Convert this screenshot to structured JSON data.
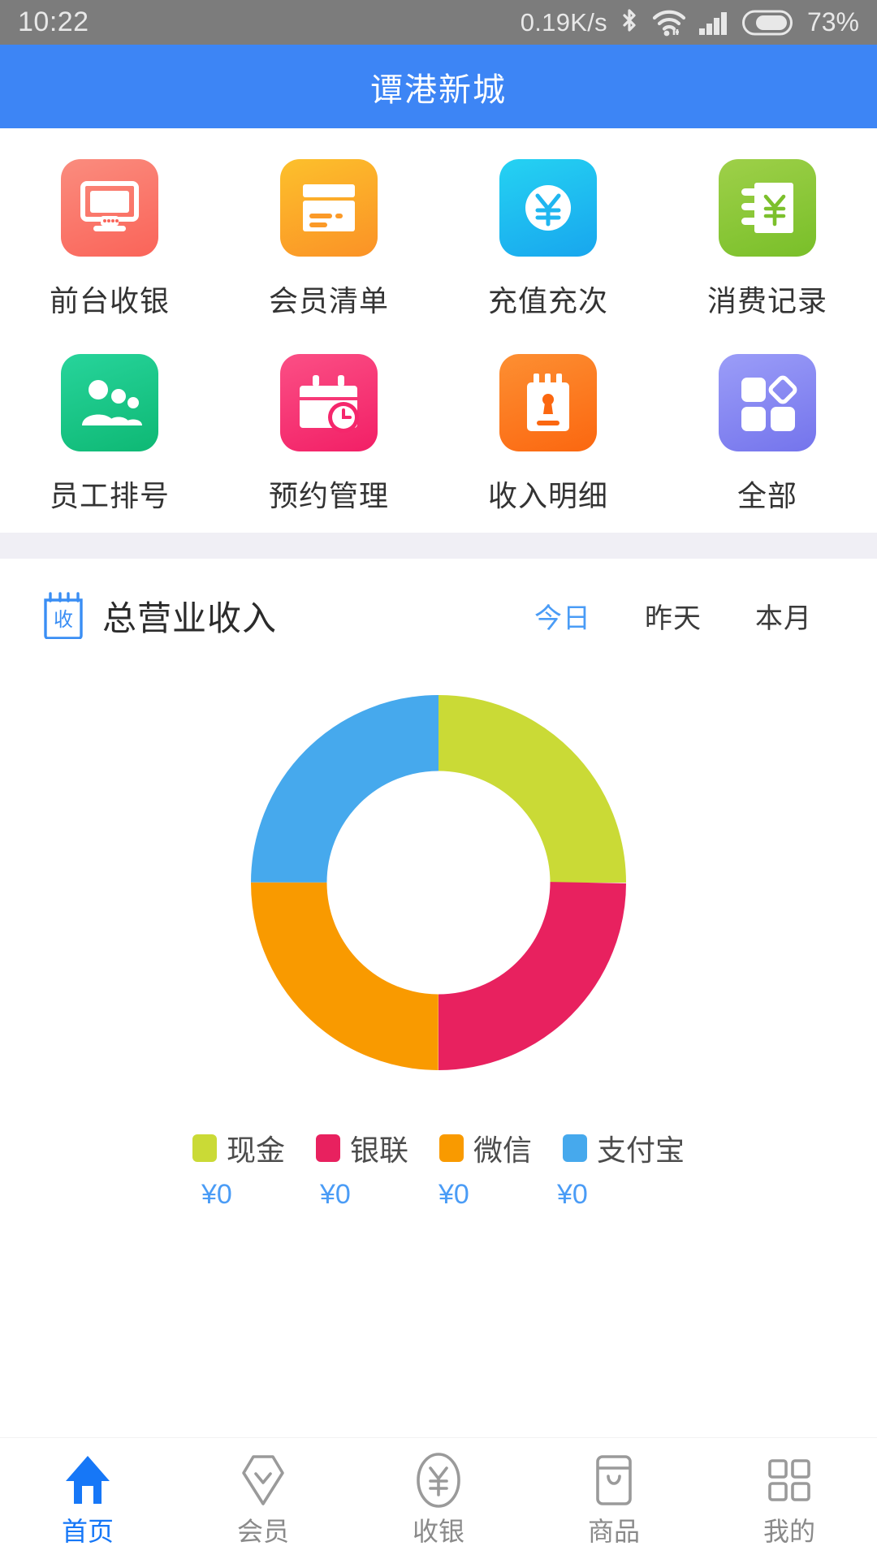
{
  "statusbar": {
    "time": "10:22",
    "network_speed": "0.19K/s",
    "bluetooth_icon": "bluetooth-icon",
    "wifi_icon": "wifi-icon",
    "signal_icon": "cellular-signal-icon",
    "battery_icon": "battery-icon",
    "battery_percent": "73%",
    "bg_color": "#7c7c7c"
  },
  "appbar": {
    "title": "谭港新城",
    "bg_color": "#3d85f5"
  },
  "grid": {
    "rows": [
      [
        {
          "label": "前台收银",
          "icon": "monitor-icon",
          "color_from": "#fa8072",
          "color_to": "#fa6459"
        },
        {
          "label": "会员清单",
          "icon": "member-card-icon",
          "color_from": "#fcc02c",
          "color_to": "#fb9226"
        },
        {
          "label": "充值充次",
          "icon": "yen-coin-icon",
          "color_from": "#23cdf0",
          "color_to": "#19a9ee"
        },
        {
          "label": "消费记录",
          "icon": "yen-notebook-icon",
          "color_from": "#96cc43",
          "color_to": "#7cc02c"
        }
      ],
      [
        {
          "label": "员工排号",
          "icon": "staff-group-icon",
          "color_from": "#1ecb8f",
          "color_to": "#0fba77"
        },
        {
          "label": "预约管理",
          "icon": "calendar-clock-icon",
          "color_from": "#fb4780",
          "color_to": "#f31f67"
        },
        {
          "label": "收入明细",
          "icon": "income-list-icon",
          "color_from": "#fd8226",
          "color_to": "#fb6a12"
        },
        {
          "label": "全部",
          "icon": "all-apps-icon",
          "color_from": "#8d92f5",
          "color_to": "#7b7bee"
        }
      ]
    ]
  },
  "revenue": {
    "icon": "revenue-clipboard-icon",
    "icon_glyph": "收",
    "title": "总营业收入",
    "tabs": [
      {
        "label": "今日",
        "active": true
      },
      {
        "label": "昨天",
        "active": false
      },
      {
        "label": "本月",
        "active": false
      }
    ],
    "accent_color": "#4a9cf6"
  },
  "chart_data": {
    "type": "pie",
    "title": "总营业收入",
    "donut": true,
    "inner_radius_ratio": 0.66,
    "categories": [
      "现金",
      "银联",
      "微信",
      "支付宝"
    ],
    "values": [
      25,
      25,
      25,
      25
    ],
    "value_labels": [
      "¥0",
      "¥0",
      "¥0",
      "¥0"
    ],
    "colors": [
      "#cada36",
      "#e8215f",
      "#f99a00",
      "#46a9ed"
    ],
    "legend_position": "bottom",
    "start_angle_deg": 0,
    "note": "Four equal quarter segments: 现金 top-right, 银联 bottom-right, 微信 bottom-left, 支付宝 top-left"
  },
  "bottomnav": {
    "items": [
      {
        "label": "首页",
        "icon": "home-icon",
        "active": true
      },
      {
        "label": "会员",
        "icon": "member-pin-icon",
        "active": false
      },
      {
        "label": "收银",
        "icon": "yen-cashier-icon",
        "active": false
      },
      {
        "label": "商品",
        "icon": "product-bag-icon",
        "active": false
      },
      {
        "label": "我的",
        "icon": "grid-profile-icon",
        "active": false
      }
    ],
    "active_color": "#1677f7",
    "inactive_color": "#8a8a8a"
  }
}
